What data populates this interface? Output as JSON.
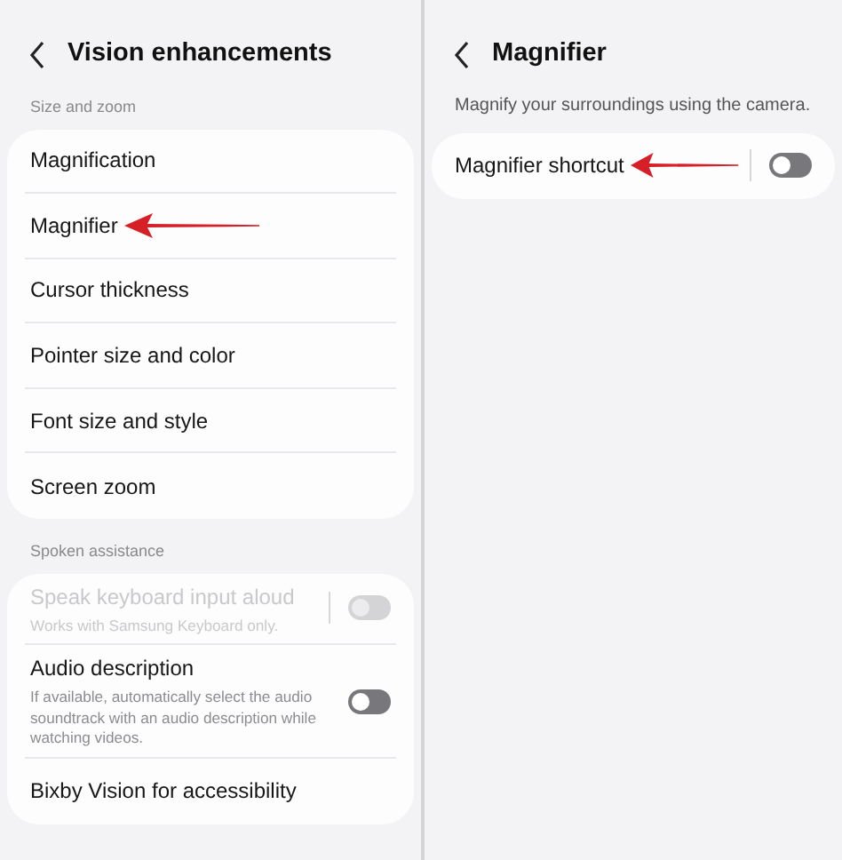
{
  "panels": [
    {
      "title": "Vision enhancements",
      "sections": [
        {
          "label": "Size and zoom",
          "items": [
            {
              "label": "Magnification"
            },
            {
              "label": "Magnifier",
              "pointer_arrow": true
            },
            {
              "label": "Cursor thickness"
            },
            {
              "label": "Pointer size and color"
            },
            {
              "label": "Font size and style"
            },
            {
              "label": "Screen zoom"
            }
          ]
        },
        {
          "label": "Spoken assistance",
          "items": [
            {
              "label": "Speak keyboard input aloud",
              "sublabel": "Works with Samsung Keyboard only.",
              "disabled": true,
              "toggle": {
                "on": false,
                "divider": true
              }
            },
            {
              "label": "Audio description",
              "sublabel": "If available, automatically select the audio soundtrack with an audio description while watching videos.",
              "disabled": false,
              "toggle": {
                "on": false,
                "divider": false
              }
            },
            {
              "label": "Bixby Vision for accessibility"
            }
          ]
        }
      ]
    },
    {
      "title": "Magnifier",
      "description": "Magnify your surroundings using the camera.",
      "sections": [
        {
          "items": [
            {
              "label": "Magnifier shortcut",
              "pointer_arrow": true,
              "disabled": false,
              "toggle": {
                "on": false,
                "divider": true
              }
            }
          ]
        }
      ]
    }
  ]
}
